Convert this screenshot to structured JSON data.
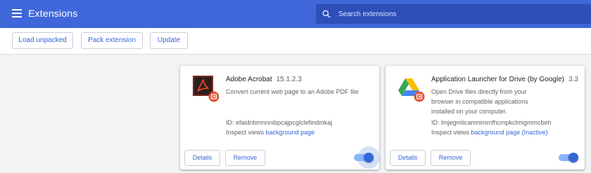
{
  "header": {
    "menu_icon": "hamburger-menu-icon",
    "title": "Extensions",
    "search": {
      "icon": "search-icon",
      "placeholder": "Search extensions",
      "value": ""
    },
    "background_color": "#3f67d9"
  },
  "toolbar": {
    "load_unpacked": "Load unpacked",
    "pack_extension": "Pack extension",
    "update": "Update"
  },
  "extensions": [
    {
      "name": "Adobe Acrobat",
      "version": "15.1.2.3",
      "description": "Convert current web page to an Adobe PDF file",
      "id_label": "ID: efaidnbmnnnibpcajpcglclefindmkaj",
      "inspect_label": "Inspect views",
      "inspect_link": "background page",
      "details_label": "Details",
      "remove_label": "Remove",
      "enabled": true,
      "icon": "adobe-acrobat-icon"
    },
    {
      "name": "Application Launcher for Drive (by Google)",
      "version": "3.3",
      "description": "Open Drive files directly from your browser in compatible applications installed on your computer.",
      "id_label": "ID: lmjegmlicamnimmfhcmpkclmigmmcbeh",
      "inspect_label": "Inspect views",
      "inspect_link": "background page (Inactive)",
      "details_label": "Details",
      "remove_label": "Remove",
      "enabled": true,
      "icon": "google-drive-icon"
    }
  ],
  "colors": {
    "accent": "#3367d6",
    "toggle_track": "#8ab4f8",
    "page_bg": "#f1f3f4"
  }
}
